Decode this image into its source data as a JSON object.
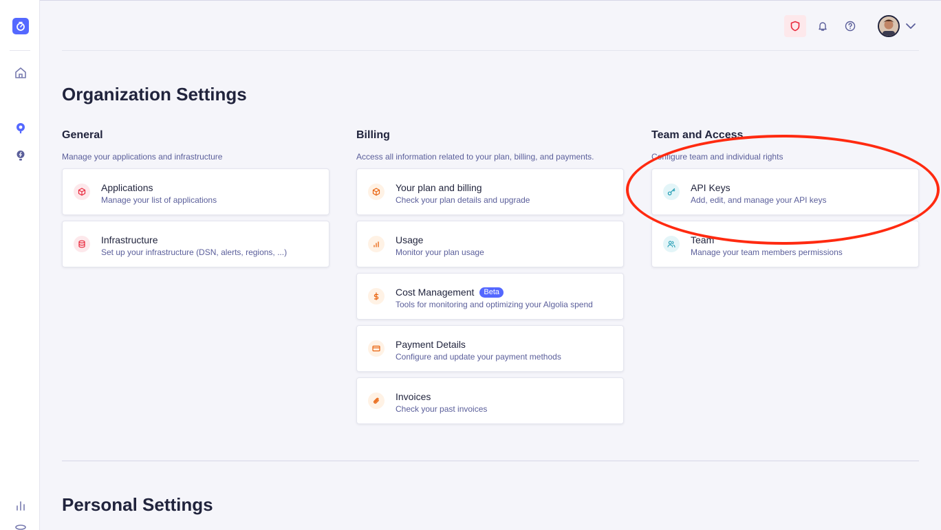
{
  "header": {
    "icons": [
      "shield-icon",
      "bell-icon",
      "help-icon"
    ],
    "avatar": "avatar",
    "menu_icon": "chevron-down-icon"
  },
  "sidebar": {
    "icons": [
      "algolia-logo",
      "home-icon",
      "search-icon",
      "lightbulb-icon",
      "chart-icon",
      "database-icon"
    ]
  },
  "page": {
    "title": "Organization Settings",
    "personal_title": "Personal Settings"
  },
  "sections": [
    {
      "title": "General",
      "description": "Manage your applications and infrastructure",
      "cards": [
        {
          "title": "Applications",
          "subtitle": "Manage your list of applications",
          "icon": "cube-icon"
        },
        {
          "title": "Infrastructure",
          "subtitle": "Set up your infrastructure (DSN, alerts, regions, ...)",
          "icon": "database-icon"
        }
      ]
    },
    {
      "title": "Billing",
      "description": "Access all information related to your plan, billing, and payments.",
      "cards": [
        {
          "title": "Your plan and billing",
          "subtitle": "Check your plan details and upgrade",
          "icon": "cube-icon"
        },
        {
          "title": "Usage",
          "subtitle": "Monitor your plan usage",
          "icon": "bar-chart-icon"
        },
        {
          "title": "Cost Management",
          "badge": "Beta",
          "subtitle": "Tools for monitoring and optimizing your Algolia spend",
          "icon": "dollar-icon"
        },
        {
          "title": "Payment Details",
          "subtitle": "Configure and update your payment methods",
          "icon": "credit-card-icon"
        },
        {
          "title": "Invoices",
          "subtitle": "Check your past invoices",
          "icon": "paperclip-icon"
        }
      ]
    },
    {
      "title": "Team and Access",
      "description": "Configure team and individual rights",
      "cards": [
        {
          "title": "API Keys",
          "subtitle": "Add, edit, and manage your API keys",
          "icon": "key-icon"
        },
        {
          "title": "Team",
          "subtitle": "Manage your team members permissions",
          "icon": "users-icon"
        }
      ]
    }
  ],
  "colors": {
    "accent": "#5468ff",
    "annotation": "#ff2a10",
    "general_icon": "#e8273b",
    "billing_icon": "#e8600a",
    "team_icon": "#1f9cb3"
  }
}
